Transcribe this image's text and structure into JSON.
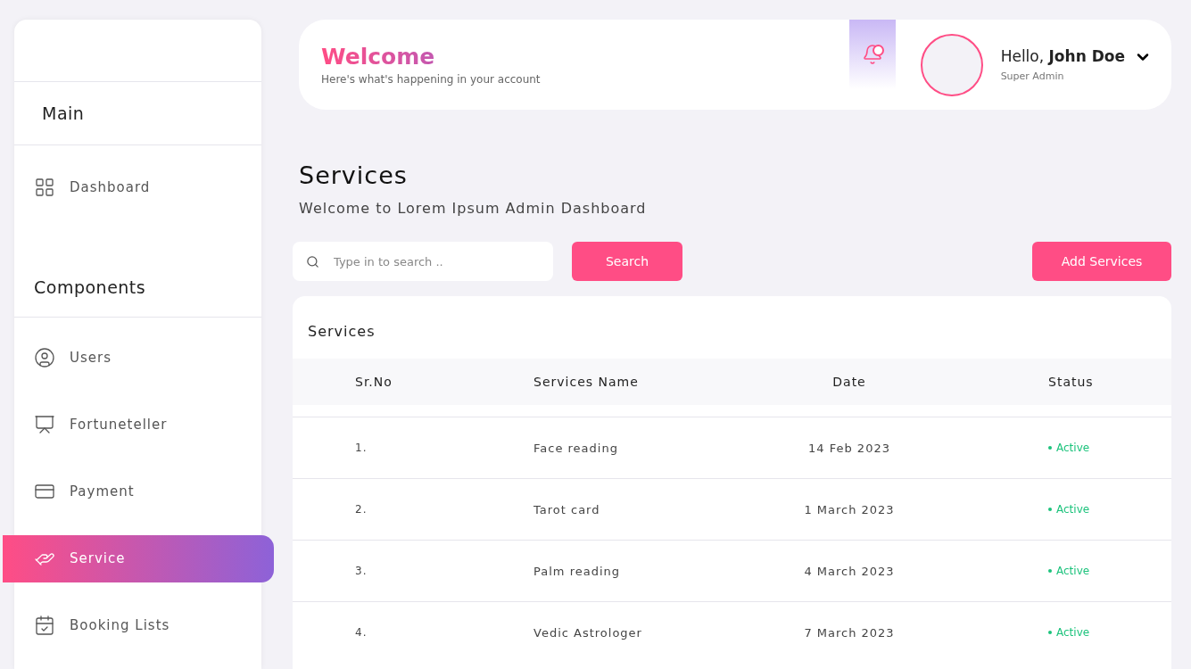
{
  "sidebar": {
    "sections": [
      {
        "title": "Main",
        "items": [
          {
            "label": "Dashboard",
            "selected": false
          }
        ]
      },
      {
        "title": "Components",
        "items": [
          {
            "label": "Users",
            "selected": false
          },
          {
            "label": "Fortuneteller",
            "selected": false
          },
          {
            "label": "Payment",
            "selected": false
          },
          {
            "label": "Service",
            "selected": true
          },
          {
            "label": "Booking Lists",
            "selected": false
          }
        ]
      }
    ]
  },
  "header": {
    "title": "Welcome",
    "subtitle": "Here's what's happening in your account",
    "notification_dot": true,
    "greeting": "Hello, **John Doe**",
    "role": "Super Admin"
  },
  "page": {
    "title": "Services",
    "subtitle": "Welcome to Lorem Ipsum Admin Dashboard"
  },
  "search": {
    "placeholder": "Type in to search ..",
    "button": "Search"
  },
  "add_button": "Add Services",
  "table": {
    "title": "Services",
    "columns": [
      "Sr.No",
      "Services Name",
      "Date",
      "Status"
    ],
    "rows": [
      {
        "no": "1.",
        "name": "Face reading",
        "date": "14 Feb 2023",
        "status": "Active",
        "active": true
      },
      {
        "no": "2.",
        "name": "Tarot card",
        "date": "1 March 2023",
        "status": "Active",
        "active": true
      },
      {
        "no": "3.",
        "name": "Palm reading",
        "date": "4 March 2023",
        "status": "Active",
        "active": true
      },
      {
        "no": "4.",
        "name": "Vedic Astrologer",
        "date": "7 March 2023",
        "status": "Active",
        "active": true
      }
    ]
  }
}
